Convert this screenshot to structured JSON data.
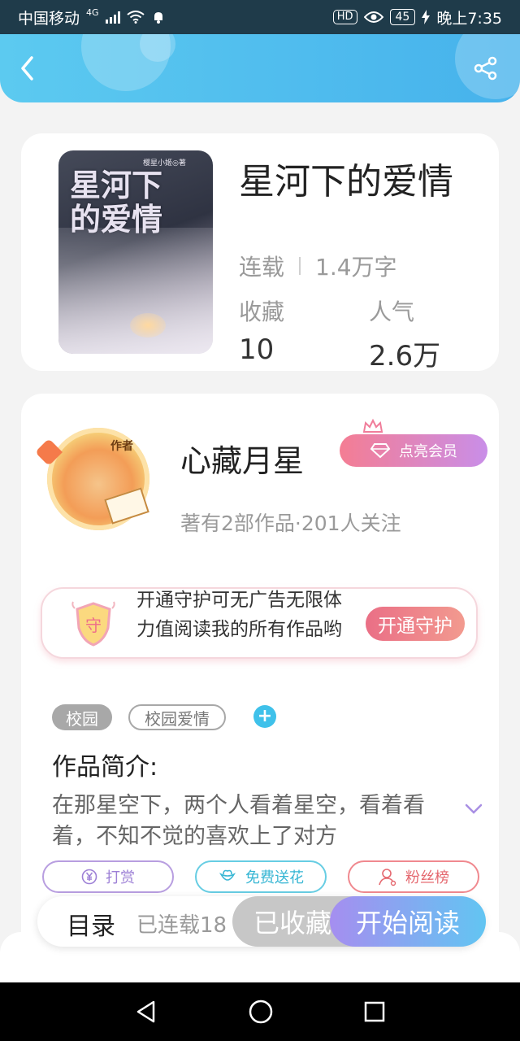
{
  "status_bar": {
    "carrier": "中国移动",
    "network": "4G",
    "hd": "HD",
    "battery": "45",
    "time": "晚上7:35"
  },
  "header": {
    "back_icon": "chevron-left-icon",
    "share_icon": "share-icon",
    "bg_color": "#4dbdee"
  },
  "book": {
    "cover": {
      "title_line1": "星河下",
      "title_line2": "的爱情",
      "author": "樱星小姬◎著"
    },
    "title": "星河下的爱情",
    "status": "连载",
    "word_count": "1.4万字",
    "stats": [
      {
        "label": "收藏",
        "value": "10"
      },
      {
        "label": "人气",
        "value": "2.6万"
      }
    ]
  },
  "author": {
    "avatar_tag": "作者",
    "name": "心藏月星",
    "vip_label": "点亮会员",
    "meta": "著有2部作品·201人关注"
  },
  "guard": {
    "shield_text": "守",
    "text": "开通守护可无广告无限体力值阅读我的所有作品哟~",
    "button": "开通守护"
  },
  "tags": [
    "校园",
    "校园爱情"
  ],
  "intro": {
    "title": "作品简介:",
    "text": "在那星空下，两个人看着星空，看着看着，不知不觉的喜欢上了对方"
  },
  "actions": [
    {
      "label": "打赏",
      "icon": "yen-icon"
    },
    {
      "label": "免费送花",
      "icon": "flower-icon"
    },
    {
      "label": "粉丝榜",
      "icon": "user-icon"
    }
  ],
  "bottom": {
    "toc_label": "目录",
    "toc_status": "已连载18",
    "collect_label": "已收藏",
    "read_label": "开始阅读"
  },
  "colors": {
    "accent_blue": "#3fc1ea",
    "vip_gradient_start": "#f47d93",
    "read_gradient_start": "#a58ef0",
    "read_gradient_end": "#62c5f2"
  }
}
